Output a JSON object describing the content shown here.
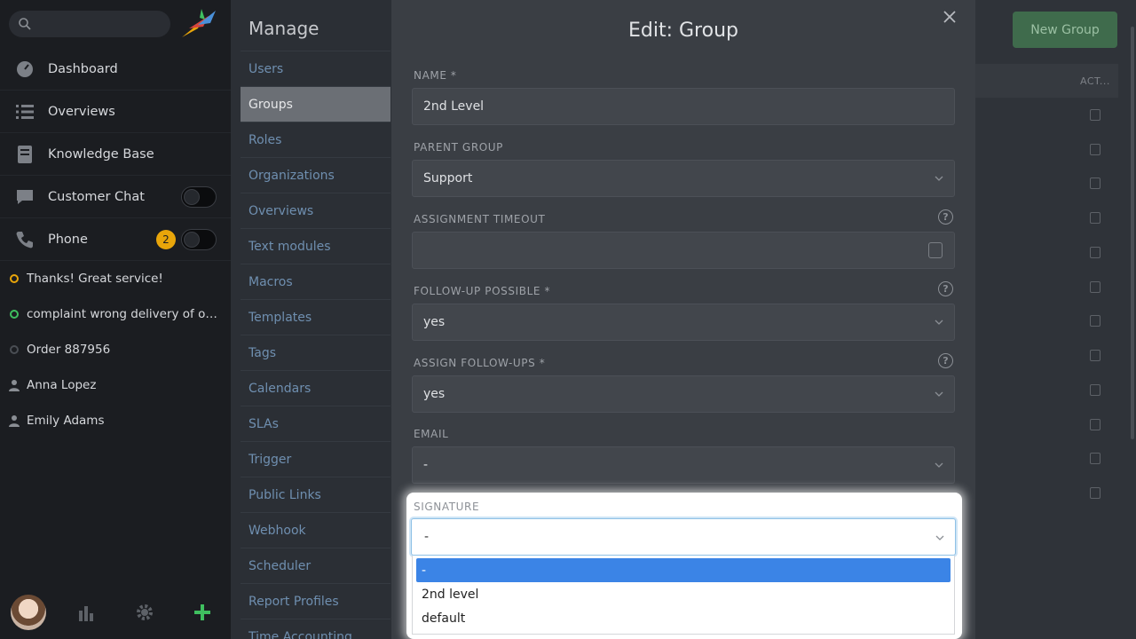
{
  "sidebar": {
    "nav": [
      {
        "label": "Dashboard",
        "icon": "dashboard-icon"
      },
      {
        "label": "Overviews",
        "icon": "list-icon"
      },
      {
        "label": "Knowledge Base",
        "icon": "book-icon"
      },
      {
        "label": "Customer Chat",
        "icon": "chat-icon"
      },
      {
        "label": "Phone",
        "icon": "phone-icon",
        "badge": "2"
      }
    ],
    "recent": [
      {
        "label": "Thanks! Great service!",
        "status_color": "#e8a50a"
      },
      {
        "label": "complaint wrong delivery of ord...",
        "status_color": "#3fbf5f"
      },
      {
        "label": "Order 887956",
        "status_color": "#4a4e54"
      },
      {
        "label": "Anna Lopez",
        "icon": "user-icon"
      },
      {
        "label": "Emily Adams",
        "icon": "user-icon"
      }
    ]
  },
  "manage": {
    "title": "Manage",
    "items": [
      "Users",
      "Groups",
      "Roles",
      "Organizations",
      "Overviews",
      "Text modules",
      "Macros",
      "Templates",
      "Tags",
      "Calendars",
      "SLAs",
      "Trigger",
      "Public Links",
      "Webhook",
      "Scheduler",
      "Report Profiles",
      "Time Accounting"
    ],
    "active": "Groups"
  },
  "main": {
    "new_group_label": "New Group",
    "actions_header": "ACT..."
  },
  "modal": {
    "title": "Edit: Group",
    "fields": {
      "name": {
        "label": "NAME *",
        "value": "2nd Level"
      },
      "parent_group": {
        "label": "PARENT GROUP",
        "value": "Support"
      },
      "assignment_timeout": {
        "label": "ASSIGNMENT TIMEOUT",
        "value": ""
      },
      "follow_up_possible": {
        "label": "FOLLOW-UP POSSIBLE *",
        "value": "yes"
      },
      "assign_follow_ups": {
        "label": "ASSIGN FOLLOW-UPS *",
        "value": "yes"
      },
      "email": {
        "label": "EMAIL",
        "value": "-"
      },
      "signature": {
        "label": "SIGNATURE",
        "value": "-"
      }
    },
    "signature_options": [
      "-",
      "2nd level",
      "default"
    ],
    "help_glyph": "?"
  },
  "colors": {
    "accent_blue": "#3b84e6",
    "badge_yellow": "#e8a50a",
    "new_group_green": "#3f6b4c"
  }
}
